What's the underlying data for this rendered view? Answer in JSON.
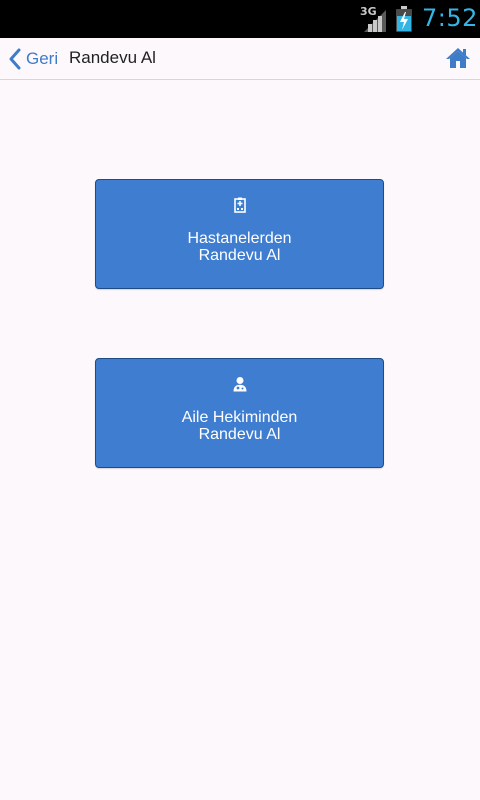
{
  "status_bar": {
    "network": "3G",
    "time": "7:52",
    "clock_color": "#33b5e5",
    "icons": [
      "signal-icon",
      "battery-charging-icon"
    ]
  },
  "header": {
    "back_label": "Geri",
    "title": "Randevu Al",
    "accent_color": "#3f7cc8",
    "icons": [
      "chevron-left-icon",
      "home-icon"
    ]
  },
  "main": {
    "buttons": [
      {
        "icon": "hospital-icon",
        "line1": "Hastanelerden",
        "line2": "Randevu Al"
      },
      {
        "icon": "doctor-icon",
        "line1": "Aile Hekiminden",
        "line2": "Randevu Al"
      }
    ],
    "button_color": "#3e7dd0"
  }
}
